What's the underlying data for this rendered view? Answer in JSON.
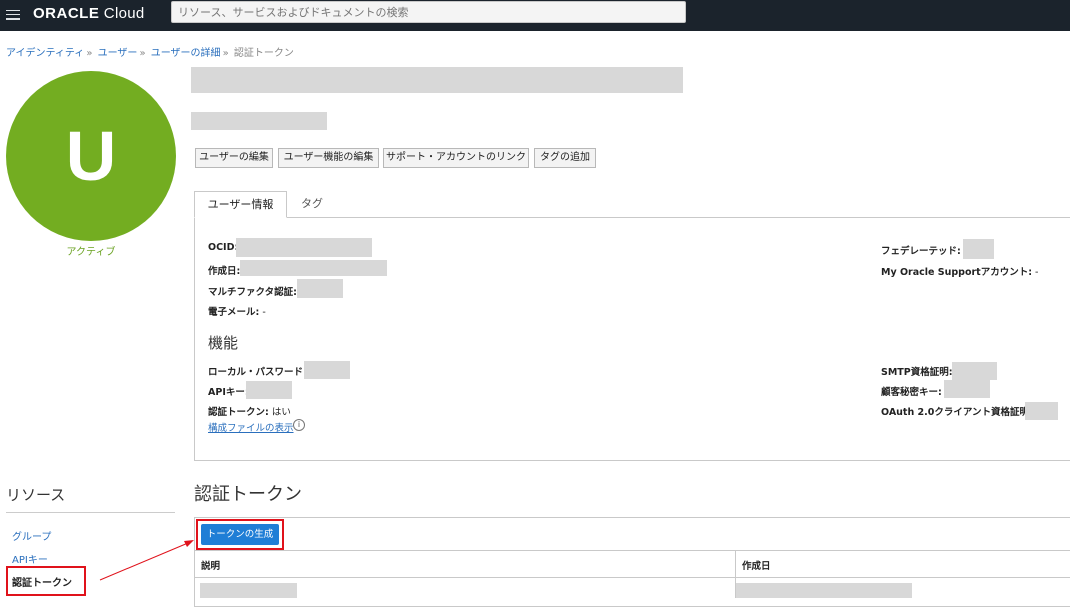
{
  "topbar": {
    "logo_brand": "ORACLE",
    "logo_product": " Cloud",
    "search_placeholder": "リソース、サービスおよびドキュメントの検索"
  },
  "breadcrumb": {
    "items": [
      "アイデンティティ",
      "ユーザー",
      "ユーザーの詳細"
    ],
    "current": "認証トークン"
  },
  "avatar": {
    "initial": "U",
    "status": "アクティブ"
  },
  "actions": {
    "edit_user": "ユーザーの編集",
    "edit_capabilities": "ユーザー機能の編集",
    "link_support": "サポート・アカウントのリンク",
    "add_tags": "タグの追加"
  },
  "tabs": {
    "user_info": "ユーザー情報",
    "tags": "タグ"
  },
  "info": {
    "ocid_label": "OCID:",
    "created_label": "作成日:",
    "mfa_label": "マルチファクタ認証:",
    "email_label": "電子メール:",
    "email_value": " -",
    "federated_label": "フェデレーテッド:",
    "mos_label": "My Oracle Supportアカウント:",
    "mos_value": " -"
  },
  "capabilities": {
    "heading": "機能",
    "local_password_label": "ローカル・パスワード:",
    "api_key_label": "APIキー:",
    "auth_token_label": "認証トークン:",
    "auth_token_value": " はい",
    "smtp_label": "SMTP資格証明:",
    "customer_secret_label": "顧客秘密キー:",
    "oauth_label": "OAuth 2.0クライアント資格証明:",
    "config_link": "構成ファイルの表示",
    "info_glyph": "i"
  },
  "resources": {
    "title": "リソース",
    "items": [
      "グループ",
      "APIキー",
      "認証トークン"
    ]
  },
  "tokens": {
    "title": "認証トークン",
    "generate_button": "トークンの生成",
    "columns": [
      "説明",
      "作成日"
    ]
  },
  "colors": {
    "accent": "#1f7ed6",
    "avatar": "#73ad21",
    "topbar": "#1b232c",
    "highlight": "#e0121b"
  },
  "icons": [
    "hamburger-menu-icon",
    "info-icon"
  ]
}
